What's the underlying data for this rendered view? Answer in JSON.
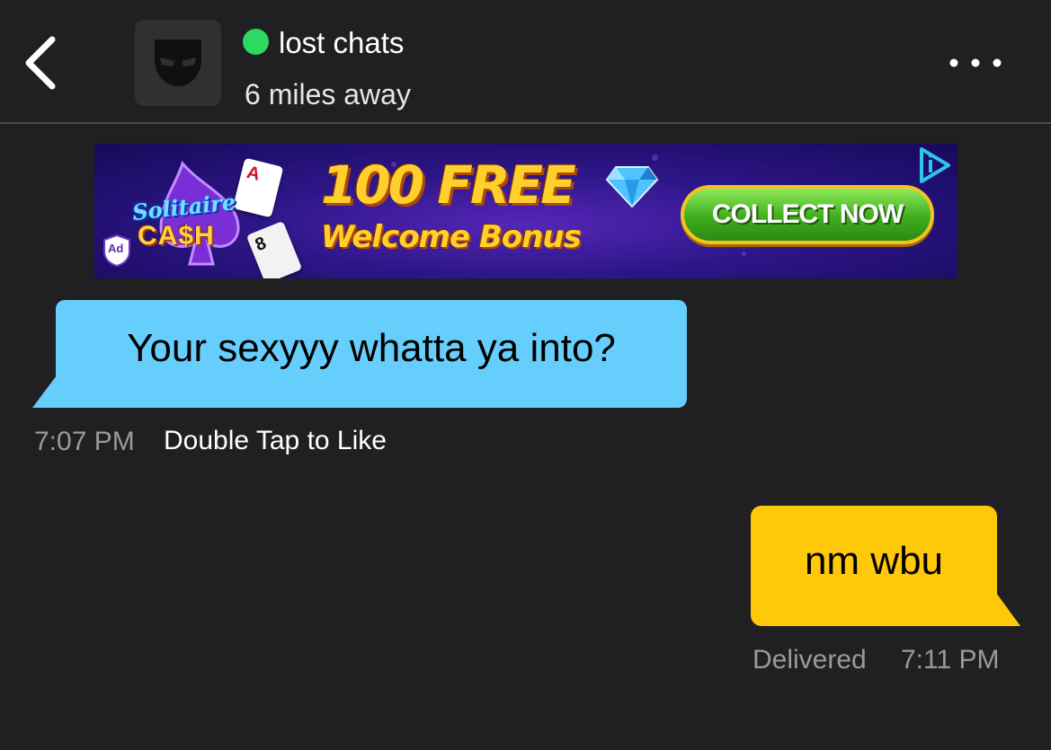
{
  "colors": {
    "background": "#202022",
    "online_status": "#2ed962",
    "incoming_bubble": "#66cefc",
    "outgoing_bubble": "#ffc80b",
    "meta_text": "#9a9a9c"
  },
  "header": {
    "back_icon": "chevron-left-icon",
    "avatar_icon": "mask-icon",
    "online": true,
    "display_name": "lost chats",
    "distance": "6 miles away",
    "more_icon": "ellipsis-horizontal-icon"
  },
  "ad": {
    "brand_line1": "Solitaire",
    "brand_line2": "CA$H",
    "badge": "Ad",
    "headline": "100 FREE",
    "subline": "Welcome Bonus",
    "cta": "COLLECT NOW",
    "choices_icon": "ad-choices-icon"
  },
  "messages": [
    {
      "direction": "incoming",
      "text": "Your sexyyy whatta ya into?",
      "time": "7:07 PM",
      "action": "Double Tap to Like"
    },
    {
      "direction": "outgoing",
      "text": "nm wbu",
      "status": "Delivered",
      "time": "7:11 PM"
    }
  ]
}
